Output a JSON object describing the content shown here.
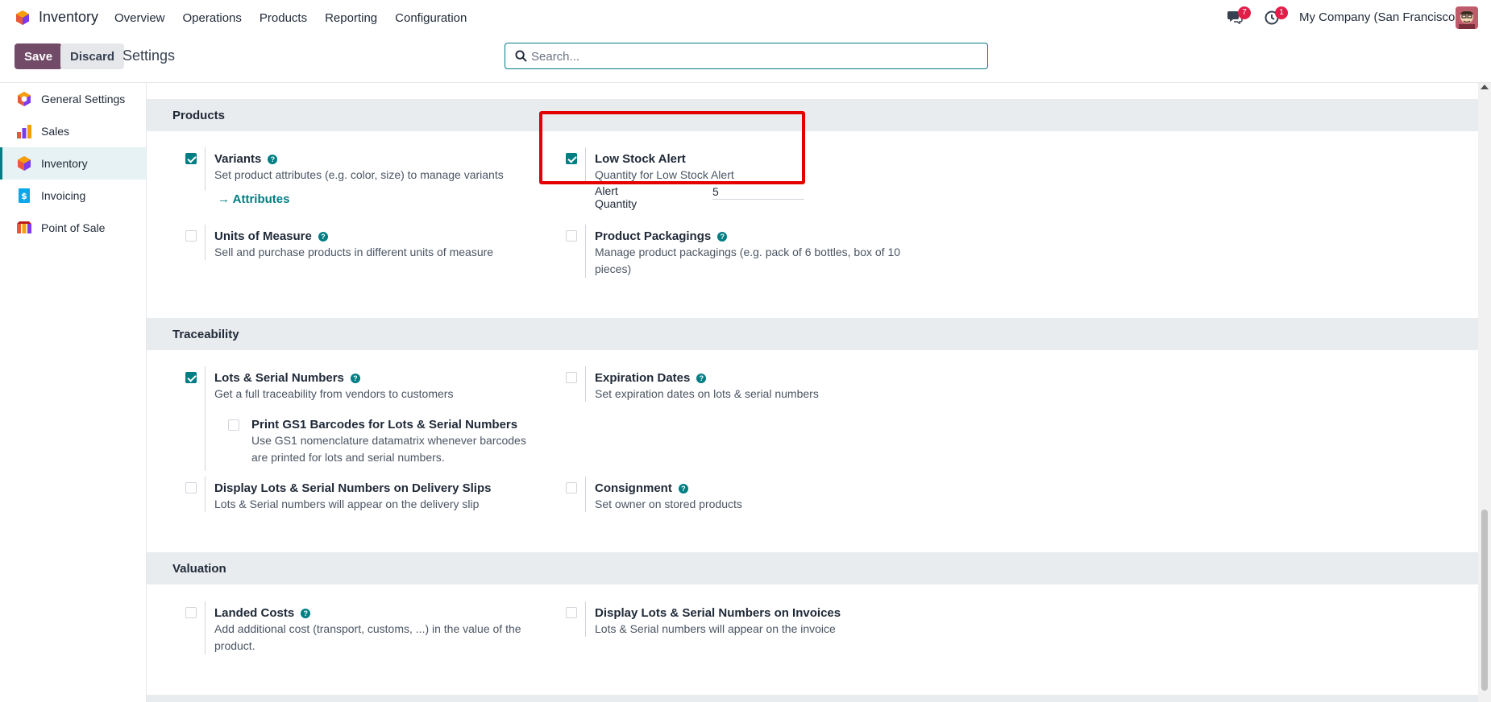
{
  "navbar": {
    "app_name": "Inventory",
    "menu": [
      "Overview",
      "Operations",
      "Products",
      "Reporting",
      "Configuration"
    ],
    "messages_count": "7",
    "activities_count": "1",
    "company": "My Company (San Francisco)"
  },
  "control": {
    "save_label": "Save",
    "discard_label": "Discard",
    "title": "Settings",
    "search_placeholder": "Search..."
  },
  "sidebar": {
    "items": [
      {
        "label": "General Settings",
        "icon": "settings-icon"
      },
      {
        "label": "Sales",
        "icon": "sales-icon"
      },
      {
        "label": "Inventory",
        "icon": "inventory-icon",
        "active": true
      },
      {
        "label": "Invoicing",
        "icon": "invoicing-icon"
      },
      {
        "label": "Point of Sale",
        "icon": "pos-icon"
      }
    ]
  },
  "sections": {
    "products": {
      "title": "Products",
      "variants": {
        "title": "Variants",
        "desc": "Set product attributes (e.g. color, size) to manage variants",
        "link": "Attributes",
        "checked": true
      },
      "low_stock": {
        "title": "Low Stock Alert",
        "desc": "Quantity for Low Stock Alert",
        "qty_label": "Alert Quantity",
        "qty_value": "5",
        "checked": true
      },
      "uom": {
        "title": "Units of Measure",
        "desc": "Sell and purchase products in different units of measure",
        "checked": false
      },
      "packagings": {
        "title": "Product Packagings",
        "desc": "Manage product packagings (e.g. pack of 6 bottles, box of 10 pieces)",
        "checked": false
      }
    },
    "traceability": {
      "title": "Traceability",
      "lots": {
        "title": "Lots & Serial Numbers",
        "desc": "Get a full traceability from vendors to customers",
        "checked": true
      },
      "gs1": {
        "title": "Print GS1 Barcodes for Lots & Serial Numbers",
        "desc": "Use GS1 nomenclature datamatrix whenever barcodes are printed for lots and serial numbers.",
        "checked": false
      },
      "expiration": {
        "title": "Expiration Dates",
        "desc": "Set expiration dates on lots & serial numbers",
        "checked": false
      },
      "delivery_slips": {
        "title": "Display Lots & Serial Numbers on Delivery Slips",
        "desc": "Lots & Serial numbers will appear on the delivery slip",
        "checked": false
      },
      "consignment": {
        "title": "Consignment",
        "desc": "Set owner on stored products",
        "checked": false
      }
    },
    "valuation": {
      "title": "Valuation",
      "landed": {
        "title": "Landed Costs",
        "desc": "Add additional cost (transport, customs, ...) in the value of the product.",
        "checked": false
      },
      "invoices": {
        "title": "Display Lots & Serial Numbers on Invoices",
        "desc": "Lots & Serial numbers will appear on the invoice",
        "checked": false
      }
    }
  },
  "colors": {
    "primary": "#714b67",
    "accent": "#017e84",
    "highlight": "#e50000",
    "badge": "#e11d48"
  }
}
